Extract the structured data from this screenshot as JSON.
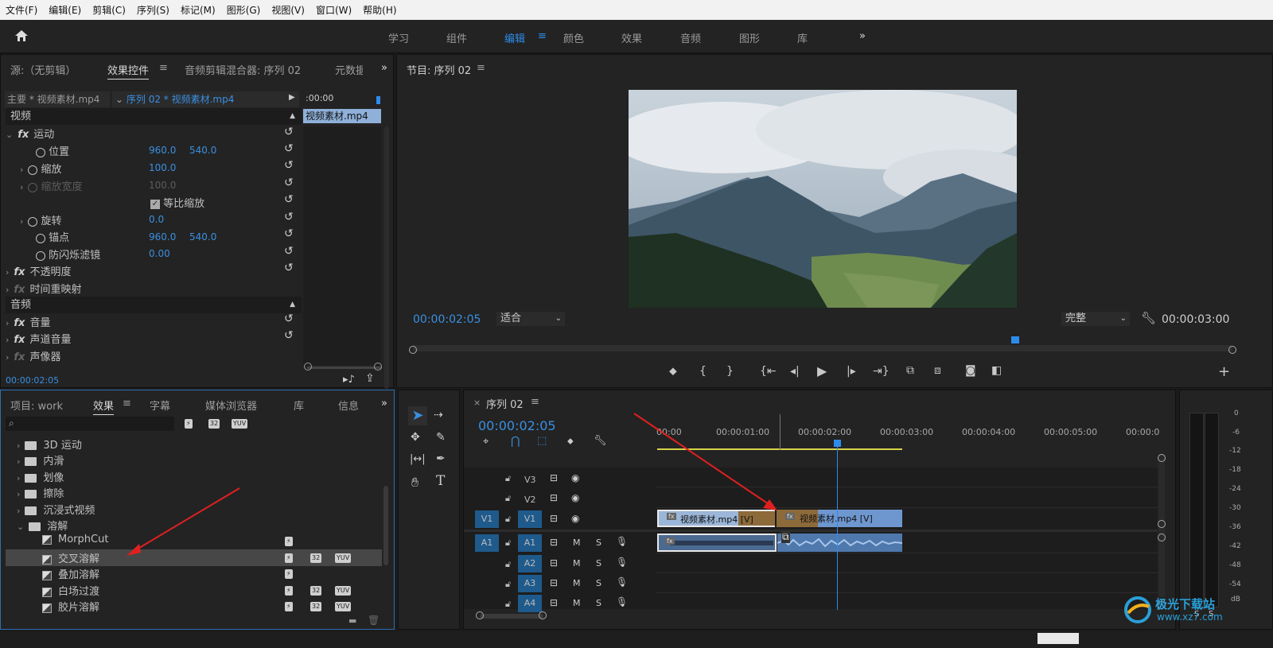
{
  "menu": [
    "文件(F)",
    "编辑(E)",
    "剪辑(C)",
    "序列(S)",
    "标记(M)",
    "图形(G)",
    "视图(V)",
    "窗口(W)",
    "帮助(H)"
  ],
  "workspaces": [
    "学习",
    "组件",
    "编辑",
    "颜色",
    "效果",
    "音频",
    "图形",
    "库"
  ],
  "active_workspace": "编辑",
  "source_panel": {
    "tabs": [
      "源:（无剪辑）",
      "效果控件",
      "音频剪辑混合器: 序列 02",
      "元数据"
    ],
    "master": "主要 * 视频素材.mp4",
    "sequence": "序列 02 * 视频素材.mp4",
    "mini_time": ":00:00",
    "mini_clip": "视频素材.mp4",
    "video_header": "视频",
    "motion": "运动",
    "props": [
      {
        "label": "位置",
        "v1": "960.0",
        "v2": "540.0"
      },
      {
        "label": "缩放",
        "v1": "100.0",
        "v2": ""
      },
      {
        "label": "缩放宽度",
        "v1": "100.0",
        "v2": ""
      },
      {
        "label": "等比缩放",
        "v1": "",
        "v2": ""
      },
      {
        "label": "旋转",
        "v1": "0.0",
        "v2": ""
      },
      {
        "label": "锚点",
        "v1": "960.0",
        "v2": "540.0"
      },
      {
        "label": "防闪烁滤镜",
        "v1": "0.00",
        "v2": ""
      }
    ],
    "opacity": "不透明度",
    "time_remap": "时间重映射",
    "audio_header": "音频",
    "volume": "音量",
    "channel_volume": "声道音量",
    "panner": "声像器",
    "timecode": "00:00:02:05"
  },
  "program": {
    "title": "节目: 序列 02",
    "timecode": "00:00:02:05",
    "fit": "适合",
    "quality": "完整",
    "duration": "00:00:03:00"
  },
  "effects_panel": {
    "tabs": [
      "项目: work",
      "效果",
      "字幕",
      "媒体浏览器",
      "库",
      "信息"
    ],
    "folders": [
      "3D 运动",
      "内滑",
      "划像",
      "擦除",
      "沉浸式视频",
      "溶解"
    ],
    "items": [
      "MorphCut",
      "交叉溶解",
      "叠加溶解",
      "白场过渡",
      "胶片溶解"
    ],
    "selected": "交叉溶解"
  },
  "timeline": {
    "title": "序列 02",
    "timecode": "00:00:02:05",
    "ruler": [
      "00:00",
      "00:00:01:00",
      "00:00:02:00",
      "00:00:03:00",
      "00:00:04:00",
      "00:00:05:00",
      "00:00:0"
    ],
    "video_tracks": [
      "V3",
      "V2",
      "V1"
    ],
    "audio_tracks": [
      "A1",
      "A2",
      "A3",
      "A4"
    ],
    "source_v": "V1",
    "source_a": "A1",
    "clip1": "视频素材.mp4 [V]",
    "clip2": "视频素材.mp4 [V]",
    "m": "M",
    "s": "S"
  },
  "meter": {
    "scale": [
      "0",
      "-6",
      "-12",
      "-18",
      "-24",
      "-30",
      "-36",
      "-42",
      "-48",
      "-54",
      "dB"
    ],
    "solo": [
      "S",
      "S"
    ]
  },
  "watermark": {
    "name": "极光下载站",
    "url": "www.xz7.com"
  }
}
